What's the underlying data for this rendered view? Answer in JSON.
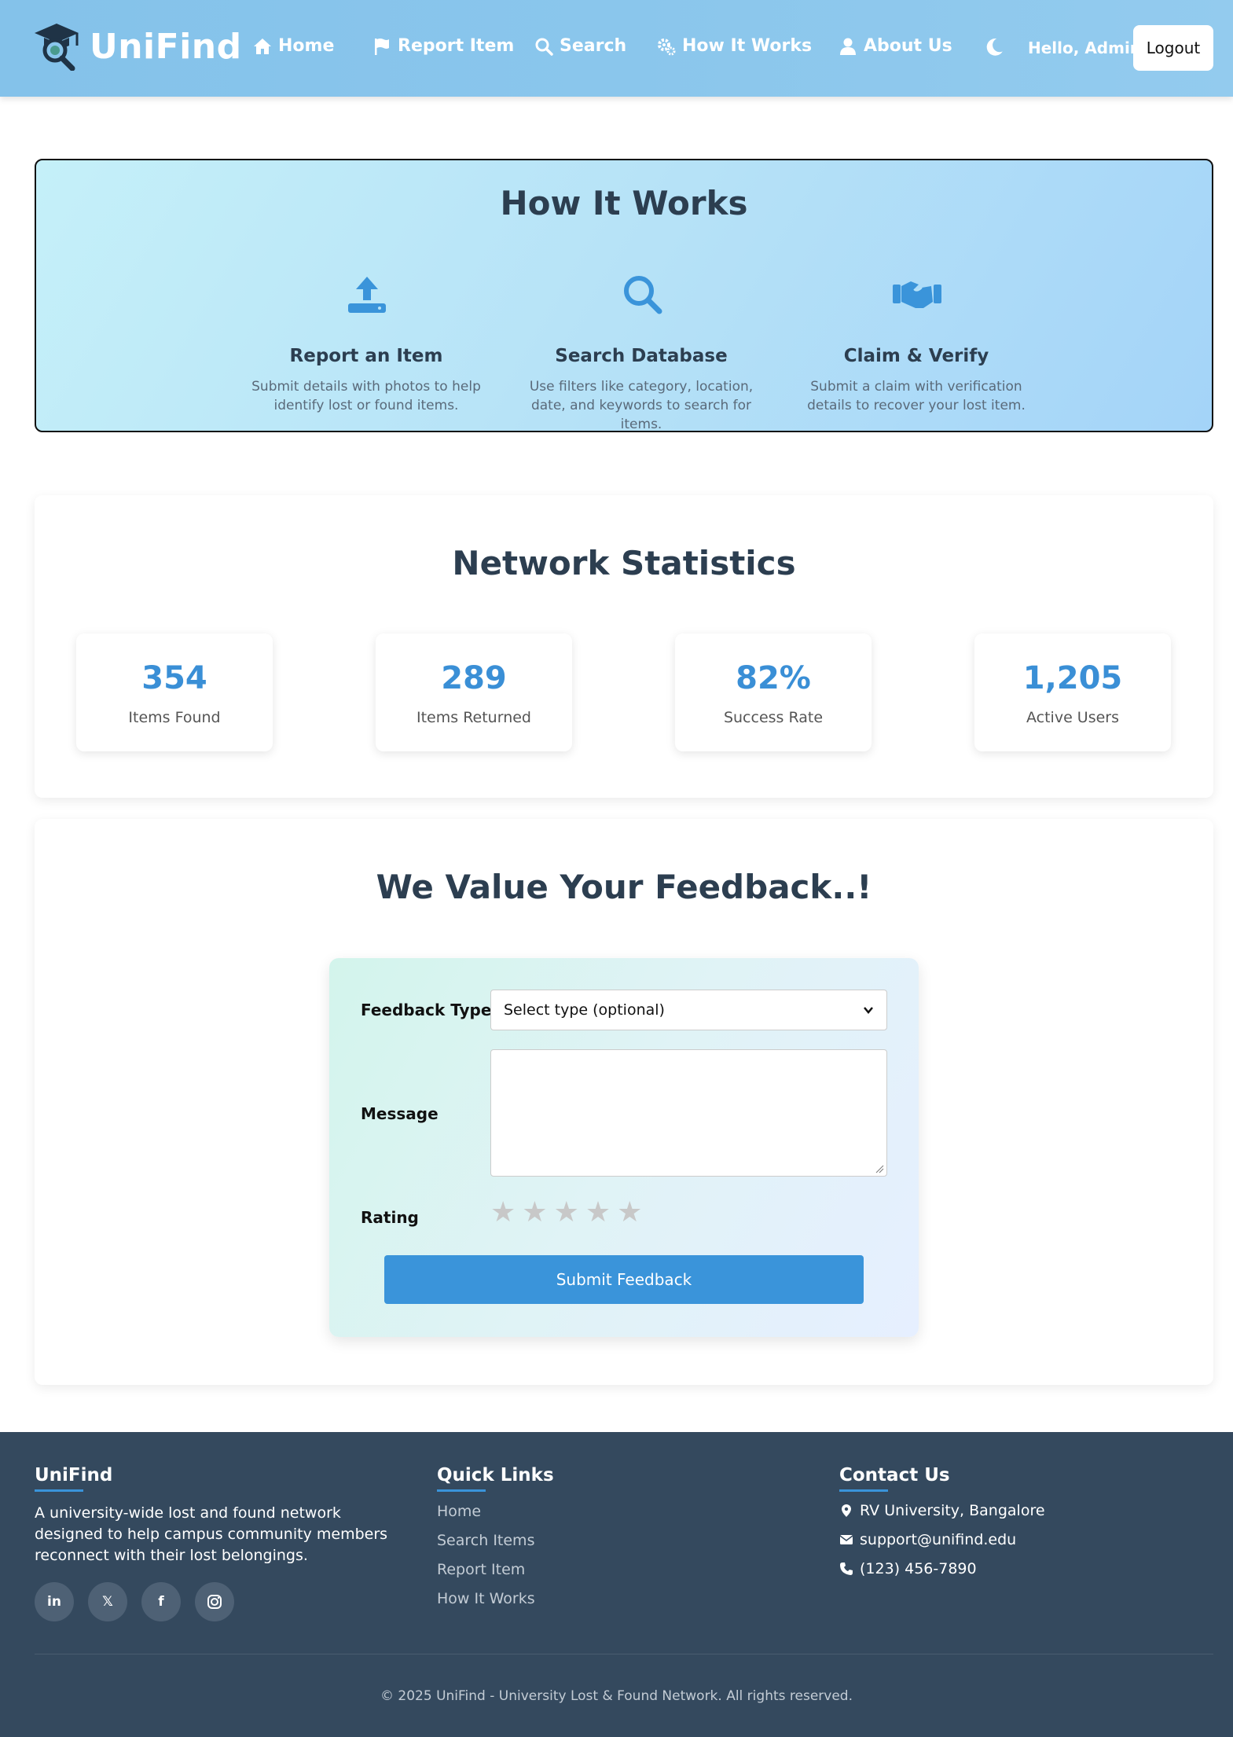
{
  "brand": {
    "name": "UniFind"
  },
  "nav": {
    "home": "Home",
    "report": "Report Item",
    "search": "Search",
    "how": "How It Works",
    "about": "About Us",
    "greeting": "Hello, Admin!",
    "logout": "Logout"
  },
  "how_it_works": {
    "title": "How It Works",
    "steps": [
      {
        "icon": "upload-icon",
        "title": "Report an Item",
        "desc": "Submit details with photos to help identify lost or found items."
      },
      {
        "icon": "search-icon",
        "title": "Search Database",
        "desc": "Use filters like category, location, date, and keywords to search for items."
      },
      {
        "icon": "handshake-icon",
        "title": "Claim & Verify",
        "desc": "Submit a claim with verification details to recover your lost item."
      }
    ]
  },
  "stats": {
    "title": "Network Statistics",
    "items": [
      {
        "value": "354",
        "label": "Items Found"
      },
      {
        "value": "289",
        "label": "Items Returned"
      },
      {
        "value": "82%",
        "label": "Success Rate"
      },
      {
        "value": "1,205",
        "label": "Active Users"
      }
    ]
  },
  "feedback": {
    "title": "We Value Your Feedback..!",
    "type_label": "Feedback Type",
    "type_value": "Select type (optional)",
    "message_label": "Message",
    "message_value": "",
    "rating_label": "Rating",
    "rating_value": 0,
    "rating_max": 5,
    "submit": "Submit Feedback"
  },
  "footer": {
    "about_heading": "UniFind",
    "about_text": "A university-wide lost and found network designed to help campus community members reconnect with their lost belongings.",
    "social": [
      {
        "icon": "linkedin-icon",
        "label": "in"
      },
      {
        "icon": "x-icon",
        "label": "𝕏"
      },
      {
        "icon": "facebook-icon",
        "label": "f"
      },
      {
        "icon": "instagram-icon",
        "label": ""
      }
    ],
    "links_heading": "Quick Links",
    "links": [
      "Home",
      "Search Items",
      "Report Item",
      "How It Works"
    ],
    "contact_heading": "Contact Us",
    "address": "RV University, Bangalore",
    "email": "support@unifind.edu",
    "phone": "(123) 456-7890",
    "copyright": "© 2025 UniFind - University Lost & Found Network. All rights reserved."
  },
  "colors": {
    "navbar": "#8ac6ec",
    "accent": "#3a94da",
    "heading": "#2c3e50",
    "footer": "#34495e",
    "star_inactive": "#c8c8c8"
  }
}
